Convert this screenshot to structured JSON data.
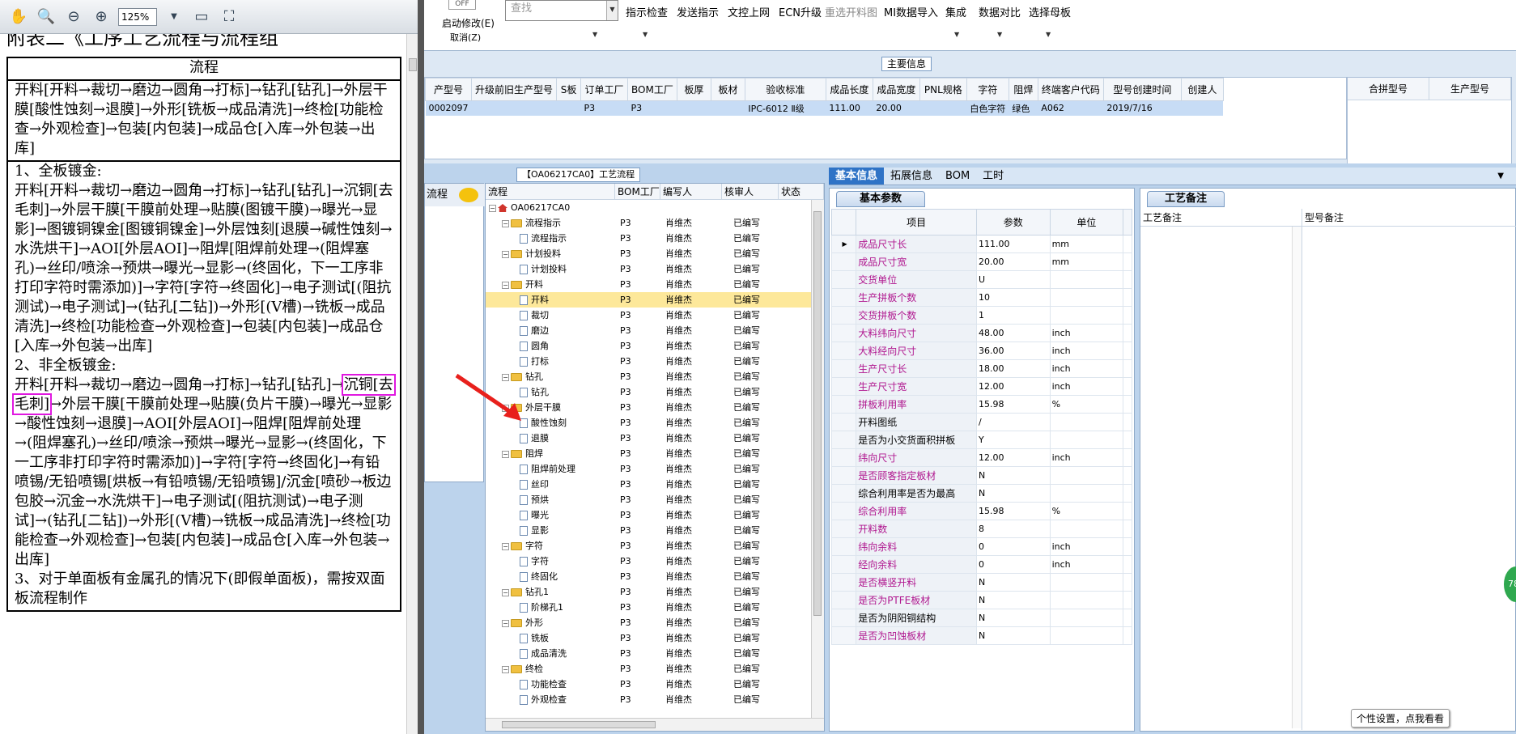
{
  "pdf": {
    "zoom": "125%",
    "title_partial": "附表二《工序工艺流程与流程组",
    "header": "流程",
    "row1": "开料[开料→裁切→磨边→圆角→打标]→钻孔[钻孔]→外层干膜[酸性蚀刻→退膜]→外形[铣板→成品清洗]→终检[功能检查→外观检查]→包装[内包装]→成品仓[入库→外包装→出库]",
    "row2_lines": [
      "1、全板镀金:",
      "开料[开料→裁切→磨边→圆角→打标]→钻孔[钻孔]→沉铜[去毛刺]→外层干膜[干膜前处理→贴膜(图镀干膜)→曝光→显影]→图镀铜镍金[图镀铜镍金]→外层蚀刻[退膜→碱性蚀刻→水洗烘干]→AOI[外层AOI]→阻焊[阻焊前处理→(阻焊塞孔)→丝印/喷涂→预烘→曝光→显影→(终固化，下一工序非打印字符时需添加)]→字符[字符→终固化]→电子测试[(阻抗测试)→电子测试]→(钻孔[二钻])→外形[(V槽)→铣板→成品清洗]→终检[功能检查→外观检查]→包装[内包装]→成品仓[入库→外包装→出库]",
      "2、非全板镀金:",
      "开料[开料→裁切→磨边→圆角→打标]→钻孔[钻孔]→"
    ],
    "highlight": "沉铜[去毛刺]",
    "row2_rest": "→外层干膜[干膜前处理→贴膜(负片干膜)→曝光→显影→酸性蚀刻→退膜]→AOI[外层AOI]→阻焊[阻焊前处理→(阻焊塞孔)→丝印/喷涂→预烘→曝光→显影→(终固化，下一工序非打印字符时需添加)]→字符[字符→终固化]→有铅喷锡/无铅喷锡[烘板→有铅喷锡/无铅喷锡]/沉金[喷砂→板边包胶→沉金→水洗烘干]→电子测试[(阻抗测试)→电子测试]→(钻孔[二钻])→外形[(V槽)→铣板→成品清洗]→终检[功能检查→外观检查]→包装[内包装]→成品仓[入库→外包装→出库]",
    "row2_last": "3、对于单面板有金属孔的情况下(即假单面板)，需按双面板流程制作"
  },
  "ribbon": {
    "off_label": "OFF",
    "start_modify": "启动修改(E)",
    "cancel": "取消(Z)",
    "search_placeholder": "查找",
    "buttons": [
      "指示检查",
      "发送指示",
      "文控上网",
      "ECN升级",
      "重选开料图",
      "MI数据导入",
      "集成",
      "数据对比",
      "选择母板"
    ]
  },
  "main_info": {
    "caption": "主要信息",
    "columns": [
      "产型号",
      "升级前旧生产型号",
      "S板",
      "订单工厂",
      "BOM工厂",
      "板厚",
      "板材",
      "验收标准",
      "成品长度",
      "成品宽度",
      "PNL规格",
      "字符",
      "阻焊",
      "终端客户代码",
      "型号创建时间",
      "创建人"
    ],
    "row": [
      "0002097",
      "",
      "",
      "P3",
      "P3",
      "",
      "",
      "IPC-6012 Ⅱ级",
      "111.00",
      "20.00",
      "",
      "白色字符",
      "绿色",
      "A062",
      "2019/7/16",
      ""
    ],
    "right_columns": [
      "合拼型号",
      "生产型号"
    ]
  },
  "left_panel": {
    "tab": "流程"
  },
  "tree": {
    "caption": "【OA06217CA0】工艺流程",
    "columns": [
      "流程",
      "BOM工厂",
      "编写人",
      "核审人",
      "状态"
    ],
    "root": "OA06217CA0",
    "rows": [
      {
        "level": 1,
        "name": "流程指示",
        "folder": true,
        "bom": "P3",
        "writer": "肖维杰",
        "status": "已编写"
      },
      {
        "level": 2,
        "name": "流程指示",
        "folder": false,
        "bom": "P3",
        "writer": "肖维杰",
        "status": "已编写"
      },
      {
        "level": 1,
        "name": "计划投料",
        "folder": true,
        "bom": "P3",
        "writer": "肖维杰",
        "status": "已编写"
      },
      {
        "level": 2,
        "name": "计划投料",
        "folder": false,
        "bom": "P3",
        "writer": "肖维杰",
        "status": "已编写"
      },
      {
        "level": 1,
        "name": "开料",
        "folder": true,
        "bom": "P3",
        "writer": "肖维杰",
        "status": "已编写"
      },
      {
        "level": 2,
        "name": "开料",
        "folder": false,
        "bom": "P3",
        "writer": "肖维杰",
        "status": "已编写",
        "selected": true
      },
      {
        "level": 2,
        "name": "裁切",
        "folder": false,
        "bom": "P3",
        "writer": "肖维杰",
        "status": "已编写"
      },
      {
        "level": 2,
        "name": "磨边",
        "folder": false,
        "bom": "P3",
        "writer": "肖维杰",
        "status": "已编写"
      },
      {
        "level": 2,
        "name": "圆角",
        "folder": false,
        "bom": "P3",
        "writer": "肖维杰",
        "status": "已编写"
      },
      {
        "level": 2,
        "name": "打标",
        "folder": false,
        "bom": "P3",
        "writer": "肖维杰",
        "status": "已编写"
      },
      {
        "level": 1,
        "name": "钻孔",
        "folder": true,
        "bom": "P3",
        "writer": "肖维杰",
        "status": "已编写"
      },
      {
        "level": 2,
        "name": "钻孔",
        "folder": false,
        "bom": "P3",
        "writer": "肖维杰",
        "status": "已编写"
      },
      {
        "level": 1,
        "name": "外层干膜",
        "folder": true,
        "bom": "P3",
        "writer": "肖维杰",
        "status": "已编写"
      },
      {
        "level": 2,
        "name": "酸性蚀刻",
        "folder": false,
        "bom": "P3",
        "writer": "肖维杰",
        "status": "已编写"
      },
      {
        "level": 2,
        "name": "退膜",
        "folder": false,
        "bom": "P3",
        "writer": "肖维杰",
        "status": "已编写"
      },
      {
        "level": 1,
        "name": "阻焊",
        "folder": true,
        "bom": "P3",
        "writer": "肖维杰",
        "status": "已编写"
      },
      {
        "level": 2,
        "name": "阻焊前处理",
        "folder": false,
        "bom": "P3",
        "writer": "肖维杰",
        "status": "已编写"
      },
      {
        "level": 2,
        "name": "丝印",
        "folder": false,
        "bom": "P3",
        "writer": "肖维杰",
        "status": "已编写"
      },
      {
        "level": 2,
        "name": "预烘",
        "folder": false,
        "bom": "P3",
        "writer": "肖维杰",
        "status": "已编写"
      },
      {
        "level": 2,
        "name": "曝光",
        "folder": false,
        "bom": "P3",
        "writer": "肖维杰",
        "status": "已编写"
      },
      {
        "level": 2,
        "name": "显影",
        "folder": false,
        "bom": "P3",
        "writer": "肖维杰",
        "status": "已编写"
      },
      {
        "level": 1,
        "name": "字符",
        "folder": true,
        "bom": "P3",
        "writer": "肖维杰",
        "status": "已编写"
      },
      {
        "level": 2,
        "name": "字符",
        "folder": false,
        "bom": "P3",
        "writer": "肖维杰",
        "status": "已编写"
      },
      {
        "level": 2,
        "name": "终固化",
        "folder": false,
        "bom": "P3",
        "writer": "肖维杰",
        "status": "已编写"
      },
      {
        "level": 1,
        "name": "钻孔1",
        "folder": true,
        "bom": "P3",
        "writer": "肖维杰",
        "status": "已编写"
      },
      {
        "level": 2,
        "name": "阶梯孔1",
        "folder": false,
        "bom": "P3",
        "writer": "肖维杰",
        "status": "已编写"
      },
      {
        "level": 1,
        "name": "外形",
        "folder": true,
        "bom": "P3",
        "writer": "肖维杰",
        "status": "已编写"
      },
      {
        "level": 2,
        "name": "铣板",
        "folder": false,
        "bom": "P3",
        "writer": "肖维杰",
        "status": "已编写"
      },
      {
        "level": 2,
        "name": "成品清洗",
        "folder": false,
        "bom": "P3",
        "writer": "肖维杰",
        "status": "已编写"
      },
      {
        "level": 1,
        "name": "终检",
        "folder": true,
        "bom": "P3",
        "writer": "肖维杰",
        "status": "已编写"
      },
      {
        "level": 2,
        "name": "功能检查",
        "folder": false,
        "bom": "P3",
        "writer": "肖维杰",
        "status": "已编写"
      },
      {
        "level": 2,
        "name": "外观检查",
        "folder": false,
        "bom": "P3",
        "writer": "肖维杰",
        "status": "已编写"
      }
    ]
  },
  "basic": {
    "tabs": [
      "基本信息",
      "拓展信息",
      "BOM",
      "工时"
    ],
    "subtab": "基本参数",
    "columns": [
      "项目",
      "参数",
      "单位"
    ],
    "rows": [
      {
        "item": "成品尺寸长",
        "value": "111.00",
        "unit": "mm",
        "pink": true
      },
      {
        "item": "成品尺寸宽",
        "value": "20.00",
        "unit": "mm",
        "pink": true
      },
      {
        "item": "交货单位",
        "value": "U",
        "unit": "",
        "pink": true
      },
      {
        "item": "生产拼板个数",
        "value": "10",
        "unit": "",
        "pink": true
      },
      {
        "item": "交货拼板个数",
        "value": "1",
        "unit": "",
        "pink": true
      },
      {
        "item": "大料纬向尺寸",
        "value": "48.00",
        "unit": "inch",
        "pink": true
      },
      {
        "item": "大料经向尺寸",
        "value": "36.00",
        "unit": "inch",
        "pink": true
      },
      {
        "item": "生产尺寸长",
        "value": "18.00",
        "unit": "inch",
        "pink": true
      },
      {
        "item": "生产尺寸宽",
        "value": "12.00",
        "unit": "inch",
        "pink": true
      },
      {
        "item": "拼板利用率",
        "value": "15.98",
        "unit": "%",
        "pink": true
      },
      {
        "item": "开料图纸",
        "value": "/",
        "unit": "",
        "pink": false
      },
      {
        "item": "是否为小交货面积拼板",
        "value": "Y",
        "unit": "",
        "pink": false
      },
      {
        "item": "纬向尺寸",
        "value": "12.00",
        "unit": "inch",
        "pink": true
      },
      {
        "item": "是否顾客指定板材",
        "value": "N",
        "unit": "",
        "pink": true
      },
      {
        "item": "综合利用率是否为最高",
        "value": "N",
        "unit": "",
        "pink": false
      },
      {
        "item": "综合利用率",
        "value": "15.98",
        "unit": "%",
        "pink": true
      },
      {
        "item": "开料数",
        "value": "8",
        "unit": "",
        "pink": true
      },
      {
        "item": "纬向余料",
        "value": "0",
        "unit": "inch",
        "pink": true
      },
      {
        "item": "经向余料",
        "value": "0",
        "unit": "inch",
        "pink": true
      },
      {
        "item": "是否横竖开料",
        "value": "N",
        "unit": "",
        "pink": true
      },
      {
        "item": "是否为PTFE板材",
        "value": "N",
        "unit": "",
        "pink": true
      },
      {
        "item": "是否为阴阳铜结构",
        "value": "N",
        "unit": "",
        "pink": false
      },
      {
        "item": "是否为凹蚀板材",
        "value": "N",
        "unit": "",
        "pink": true
      }
    ]
  },
  "remark": {
    "subtab": "工艺备注",
    "col_a": "工艺备注",
    "col_b": "型号备注"
  },
  "tip": "个性设置，点我看看",
  "badge": "78"
}
